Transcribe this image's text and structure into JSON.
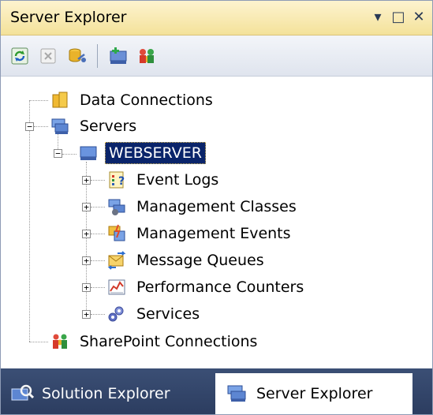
{
  "panel": {
    "title": "Server Explorer",
    "controls": {
      "dropdown_glyph": "▾",
      "maximize_glyph": "□",
      "close_glyph": "✕"
    }
  },
  "toolbar": {
    "buttons": [
      {
        "name": "refresh-icon"
      },
      {
        "name": "stop-refresh-icon"
      },
      {
        "name": "connect-to-database-icon"
      },
      {
        "name": "connect-to-server-icon"
      },
      {
        "name": "connect-to-sharepoint-icon"
      }
    ]
  },
  "tree": {
    "data_connections": "Data Connections",
    "servers": "Servers",
    "webserver": "WEBSERVER",
    "children": [
      {
        "label": "Event Logs",
        "icon": "event-logs-icon"
      },
      {
        "label": "Management Classes",
        "icon": "management-classes-icon"
      },
      {
        "label": "Management Events",
        "icon": "management-events-icon"
      },
      {
        "label": "Message Queues",
        "icon": "message-queues-icon"
      },
      {
        "label": "Performance Counters",
        "icon": "performance-counters-icon"
      },
      {
        "label": "Services",
        "icon": "services-icon"
      }
    ],
    "sharepoint": "SharePoint Connections",
    "expander_plus": "+",
    "expander_minus": "−"
  },
  "tabs": {
    "solution_explorer": "Solution Explorer",
    "server_explorer": "Server Explorer"
  },
  "colors": {
    "selection": "#0a246a",
    "title_gradient_top": "#fdf3cf",
    "tab_bar": "#3b4f75"
  }
}
